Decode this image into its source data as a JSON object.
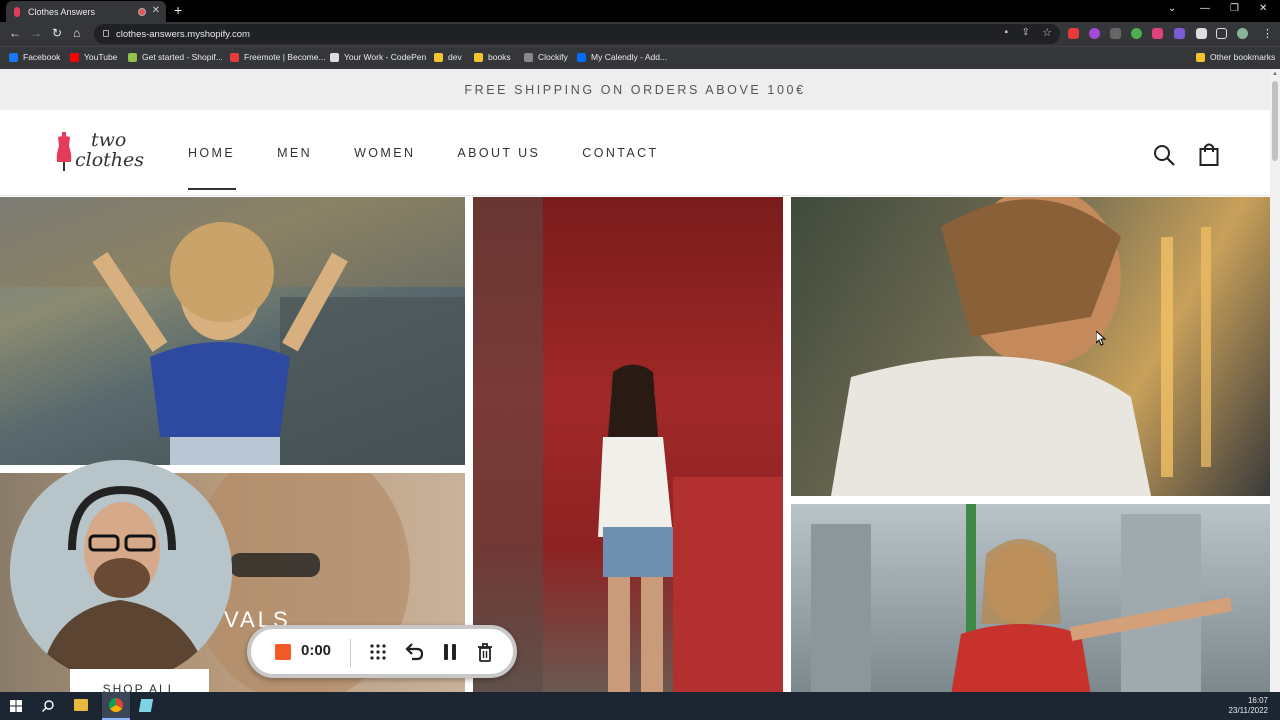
{
  "browser": {
    "tab_title": "Clothes Answers",
    "url": "clothes-answers.myshopify.com",
    "bookmarks": [
      {
        "label": "Facebook",
        "color": "#1877f2"
      },
      {
        "label": "YouTube",
        "color": "#ff0000"
      },
      {
        "label": "Get started - Shopif...",
        "color": "#95bf47"
      },
      {
        "label": "Freemote | Become...",
        "color": "#e53b3b"
      },
      {
        "label": "Your Work - CodePen",
        "color": "#dddddd"
      },
      {
        "label": "dev",
        "color": "#f4c430"
      },
      {
        "label": "books",
        "color": "#f4c430"
      },
      {
        "label": "Clockify",
        "color": "#888888"
      },
      {
        "label": "My Calendly - Add...",
        "color": "#006bff"
      }
    ],
    "other_bookmarks": "Other bookmarks"
  },
  "store": {
    "announcement": "FREE SHIPPING ON ORDERS ABOVE 100€",
    "logo_line1": "two",
    "logo_line2": "clothes",
    "accent": "#e53b5b",
    "nav": [
      {
        "label": "HOME",
        "active": true
      },
      {
        "label": "MEN",
        "active": false
      },
      {
        "label": "WOMEN",
        "active": false
      },
      {
        "label": "ABOUT US",
        "active": false
      },
      {
        "label": "CONTACT",
        "active": false
      }
    ],
    "icons": [
      "search-icon",
      "shopping-bag-icon"
    ],
    "hero_text_fragment": "VALS",
    "shop_all_label": "SHOP ALL"
  },
  "recorder": {
    "time": "0:00",
    "stop_color": "#f15a24",
    "icons": [
      "stop-icon",
      "move-icon",
      "undo-icon",
      "pause-icon",
      "delete-icon"
    ]
  },
  "taskbar": {
    "time": "16:07",
    "date": "23/11/2022"
  }
}
